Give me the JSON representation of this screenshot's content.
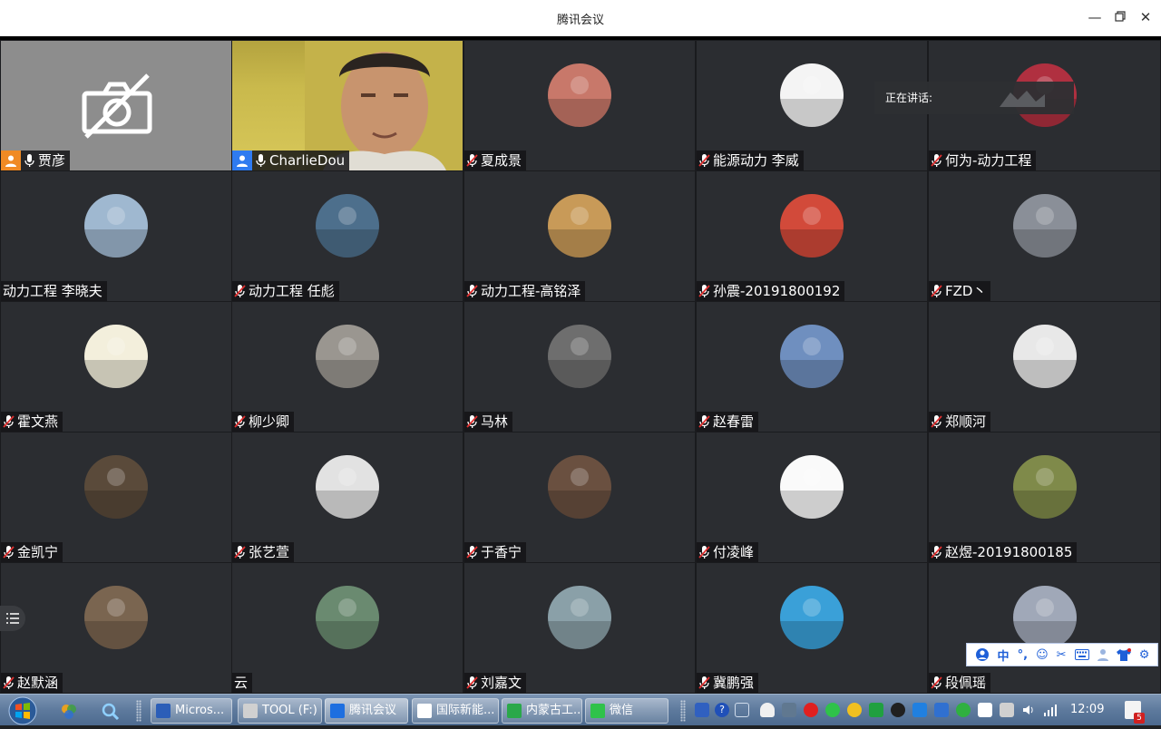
{
  "window": {
    "title": "腾讯会议"
  },
  "speaking": {
    "label": "正在讲话:"
  },
  "participants": [
    {
      "name": "贾彦",
      "state": "camera-off",
      "mic": "on",
      "host": true
    },
    {
      "name": "CharlieDou",
      "state": "video",
      "mic": "on",
      "host": true
    },
    {
      "name": "夏成景",
      "state": "avatar",
      "mic": "muted",
      "avatar_color": "#c8786a"
    },
    {
      "name": "能源动力 李威",
      "state": "avatar",
      "mic": "muted",
      "avatar_color": "#f4f4f4"
    },
    {
      "name": "何为-动力工程",
      "state": "avatar",
      "mic": "muted",
      "avatar_color": "#b03040"
    },
    {
      "name": "动力工程 李晓夫",
      "state": "avatar",
      "mic": "none",
      "avatar_color": "#9fb8d0"
    },
    {
      "name": "动力工程  任彪",
      "state": "avatar",
      "mic": "muted",
      "avatar_color": "#4d6f8c"
    },
    {
      "name": "动力工程-高铭泽",
      "state": "avatar",
      "mic": "muted",
      "avatar_color": "#c89a58"
    },
    {
      "name": "孙震-20191800192",
      "state": "avatar",
      "mic": "muted",
      "avatar_color": "#d24a3a"
    },
    {
      "name": "FZD丶",
      "state": "avatar",
      "mic": "muted",
      "avatar_color": "#8a8f98"
    },
    {
      "name": "霍文燕",
      "state": "avatar",
      "mic": "muted",
      "avatar_color": "#f3efdc"
    },
    {
      "name": "柳少卿",
      "state": "avatar",
      "mic": "muted",
      "avatar_color": "#9a9690"
    },
    {
      "name": "马林",
      "state": "avatar",
      "mic": "muted",
      "avatar_color": "#6e6e6e"
    },
    {
      "name": "赵春雷",
      "state": "avatar",
      "mic": "muted",
      "avatar_color": "#6f8fbf"
    },
    {
      "name": "郑顺河",
      "state": "avatar",
      "mic": "muted",
      "avatar_color": "#e8e8e8"
    },
    {
      "name": "金凯宁",
      "state": "avatar",
      "mic": "muted",
      "avatar_color": "#5a4a3a"
    },
    {
      "name": "张艺萱",
      "state": "avatar",
      "mic": "muted",
      "avatar_color": "#e2e2e2"
    },
    {
      "name": "于香宁",
      "state": "avatar",
      "mic": "muted",
      "avatar_color": "#6a5040"
    },
    {
      "name": "付凌峰",
      "state": "avatar",
      "mic": "muted",
      "avatar_color": "#fafafa"
    },
    {
      "name": "赵煜-20191800185",
      "state": "avatar",
      "mic": "muted",
      "avatar_color": "#7f8a4a"
    },
    {
      "name": "赵默涵",
      "state": "avatar",
      "mic": "muted",
      "avatar_color": "#7a6550"
    },
    {
      "name": "云",
      "state": "avatar",
      "mic": "none",
      "avatar_color": "#6a8a70"
    },
    {
      "name": "刘嘉文",
      "state": "avatar",
      "mic": "muted",
      "avatar_color": "#8aa0a8"
    },
    {
      "name": "冀鹏强",
      "state": "avatar",
      "mic": "muted",
      "avatar_color": "#3aa0d8"
    },
    {
      "name": "段佩瑶",
      "state": "avatar",
      "mic": "muted",
      "avatar_color": "#a0a8b8"
    }
  ],
  "ime": {
    "mode": "中",
    "punct": "°,"
  },
  "taskbar": {
    "items": [
      {
        "label": "Micros...",
        "color": "#2b5eb8"
      },
      {
        "label": "TOOL (F:)",
        "color": "#d0d0d0"
      },
      {
        "label": "腾讯会议",
        "color": "#1e6fe0"
      },
      {
        "label": "国际新能...",
        "color": "#ffffff"
      },
      {
        "label": "内蒙古工...",
        "color": "#2aa84a"
      },
      {
        "label": "微信",
        "color": "#2fc24a"
      }
    ],
    "clock": "12:09",
    "notify_count": "5"
  }
}
